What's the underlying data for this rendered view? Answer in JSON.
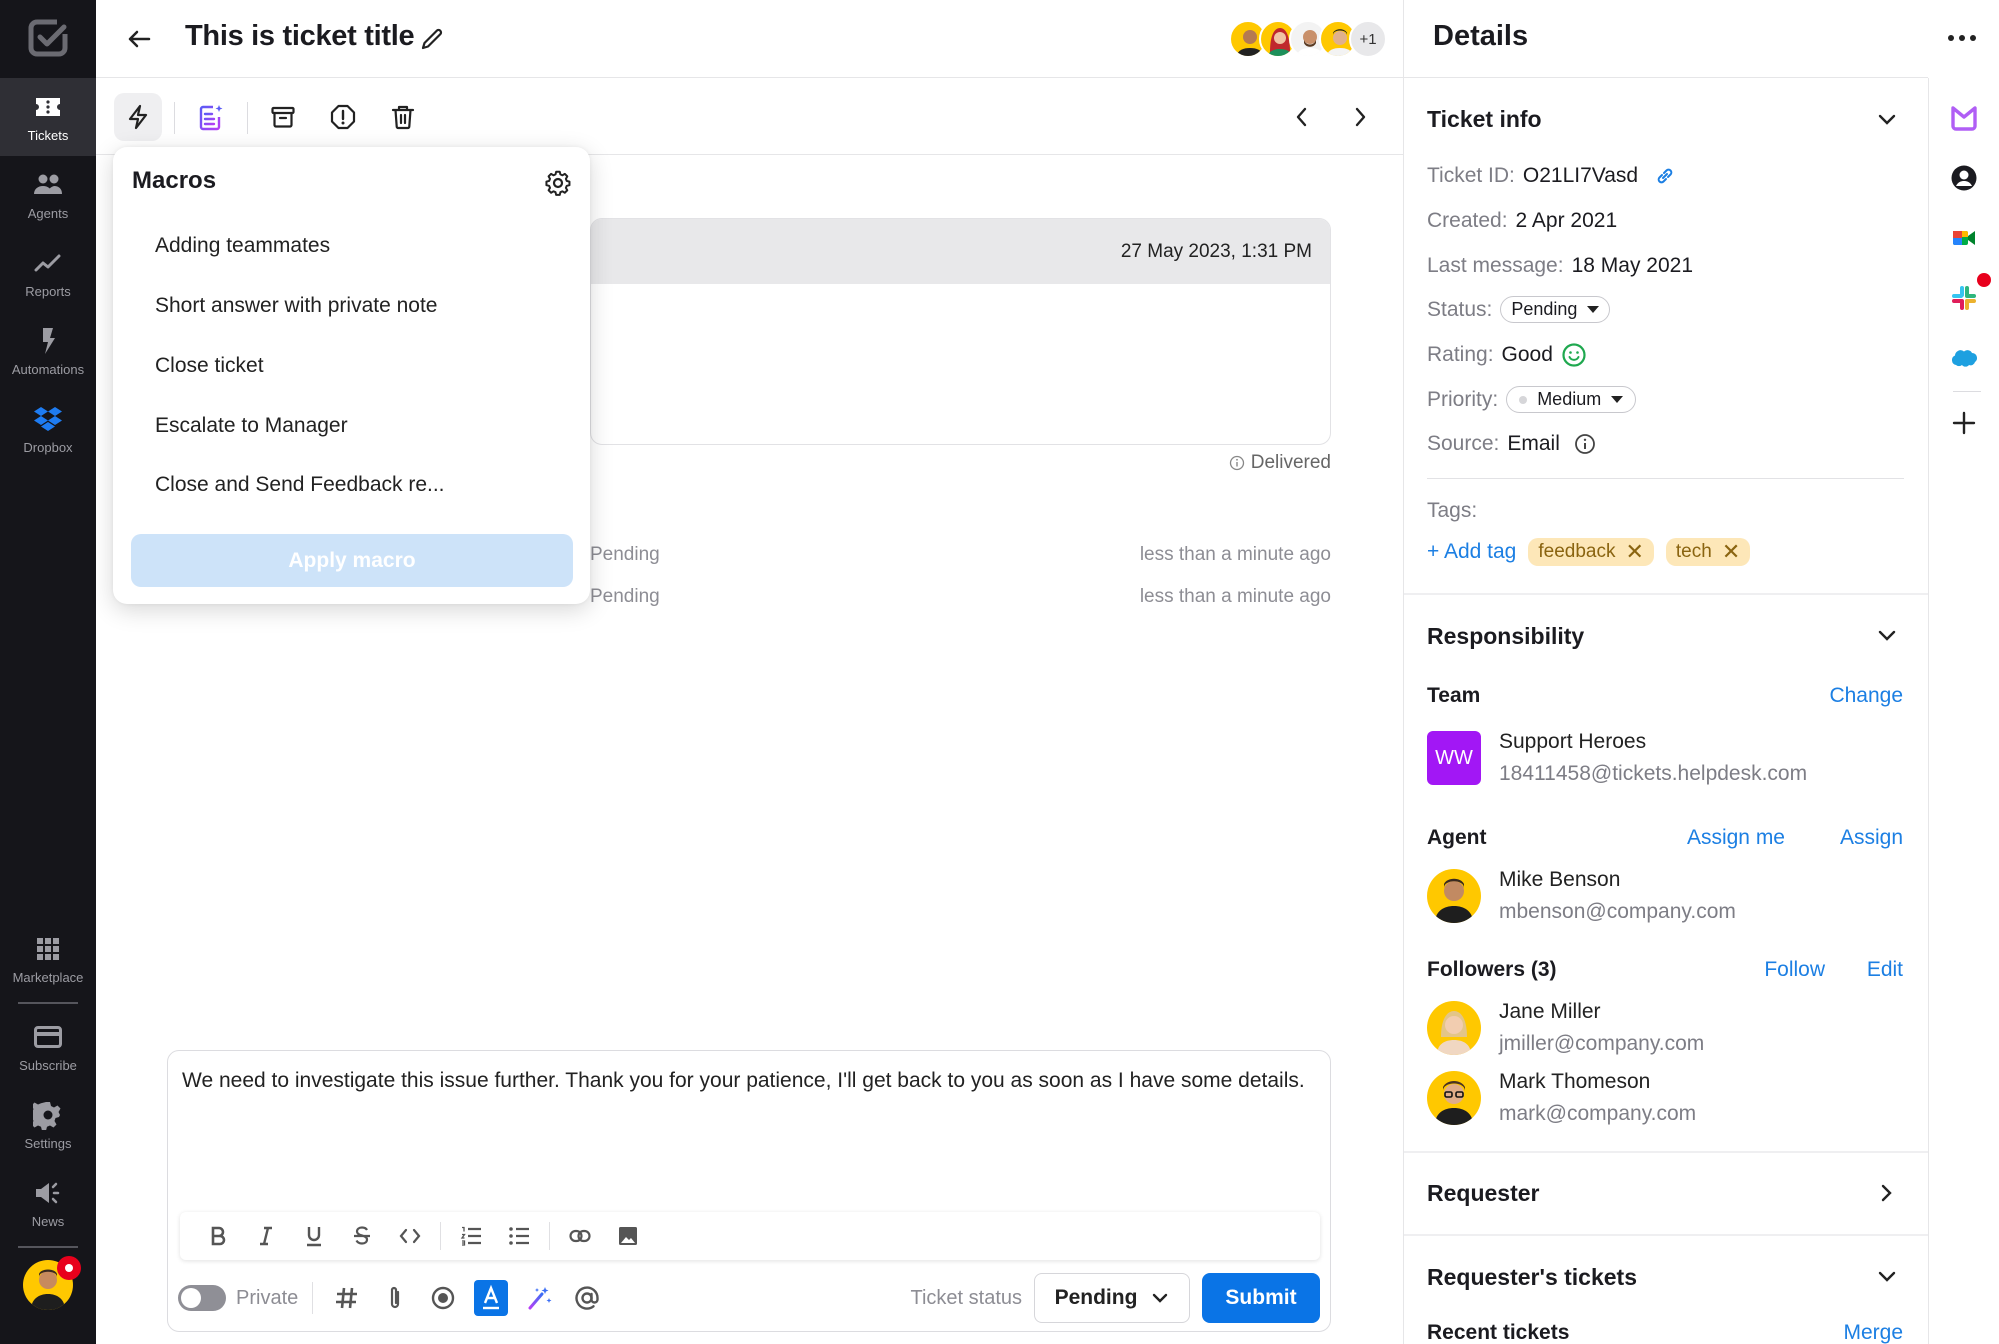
{
  "nav": {
    "items": [
      {
        "label": "Tickets",
        "icon": "ticket-icon",
        "active": true
      },
      {
        "label": "Agents",
        "icon": "agents-icon"
      },
      {
        "label": "Reports",
        "icon": "reports-icon"
      },
      {
        "label": "Automations",
        "icon": "automations-icon"
      },
      {
        "label": "Dropbox",
        "icon": "dropbox-icon"
      }
    ],
    "bottom_items": [
      {
        "label": "Marketplace",
        "icon": "grid-icon"
      },
      {
        "label": "Subscribe",
        "icon": "credit-card-icon"
      },
      {
        "label": "Settings",
        "icon": "gear-icon"
      },
      {
        "label": "News",
        "icon": "megaphone-icon"
      }
    ]
  },
  "header": {
    "title": "This is ticket title",
    "participants_more": "+1"
  },
  "macros": {
    "title": "Macros",
    "items": [
      "Adding teammates",
      "Short answer with private note",
      "Close ticket",
      "Escalate to Manager",
      "Close and Send Feedback re..."
    ],
    "apply_label": "Apply macro"
  },
  "conversation": {
    "message_timestamp": "27 May 2023, 1:31 PM",
    "delivered_label": "Delivered",
    "events": [
      {
        "status": "Pending",
        "time": "less than a minute ago"
      },
      {
        "status": "Pending",
        "time": "less than a minute ago"
      }
    ]
  },
  "composer": {
    "text": "We need to investigate this issue further. Thank you for your patience, I'll get back to you as soon as I have some details.",
    "private_label": "Private",
    "ticket_status_label": "Ticket status",
    "ticket_status_value": "Pending",
    "submit_label": "Submit"
  },
  "details": {
    "title": "Details",
    "ticket_info": {
      "title": "Ticket info",
      "ticket_id_label": "Ticket ID:",
      "ticket_id": "O21LI7Vasd",
      "created_label": "Created:",
      "created": "2 Apr 2021",
      "last_message_label": "Last message:",
      "last_message": "18 May 2021",
      "status_label": "Status:",
      "status": "Pending",
      "rating_label": "Rating:",
      "rating": "Good",
      "priority_label": "Priority:",
      "priority": "Medium",
      "source_label": "Source:",
      "source": "Email",
      "tags_label": "Tags:",
      "add_tag": "+ Add tag",
      "tags": [
        "feedback",
        "tech"
      ]
    },
    "responsibility": {
      "title": "Responsibility",
      "team_label": "Team",
      "team_change": "Change",
      "team_initials": "WW",
      "team_name": "Support Heroes",
      "team_email": "18411458@tickets.helpdesk.com",
      "agent_label": "Agent",
      "assign_me": "Assign me",
      "assign": "Assign",
      "agent_name": "Mike Benson",
      "agent_email": "mbenson@company.com",
      "followers_label": "Followers (3)",
      "follow": "Follow",
      "edit": "Edit",
      "followers": [
        {
          "name": "Jane Miller",
          "email": "jmiller@company.com"
        },
        {
          "name": "Mark Thomeson",
          "email": "mark@company.com"
        }
      ]
    },
    "requester": {
      "title": "Requester"
    },
    "requester_tickets": {
      "title": "Requester's tickets",
      "recent_label": "Recent tickets",
      "merge": "Merge"
    }
  },
  "colors": {
    "accent": "#0a74e6",
    "nav_bg": "#15151a",
    "tag_bg": "#fde7b8",
    "team_badge": "#a217f5"
  }
}
